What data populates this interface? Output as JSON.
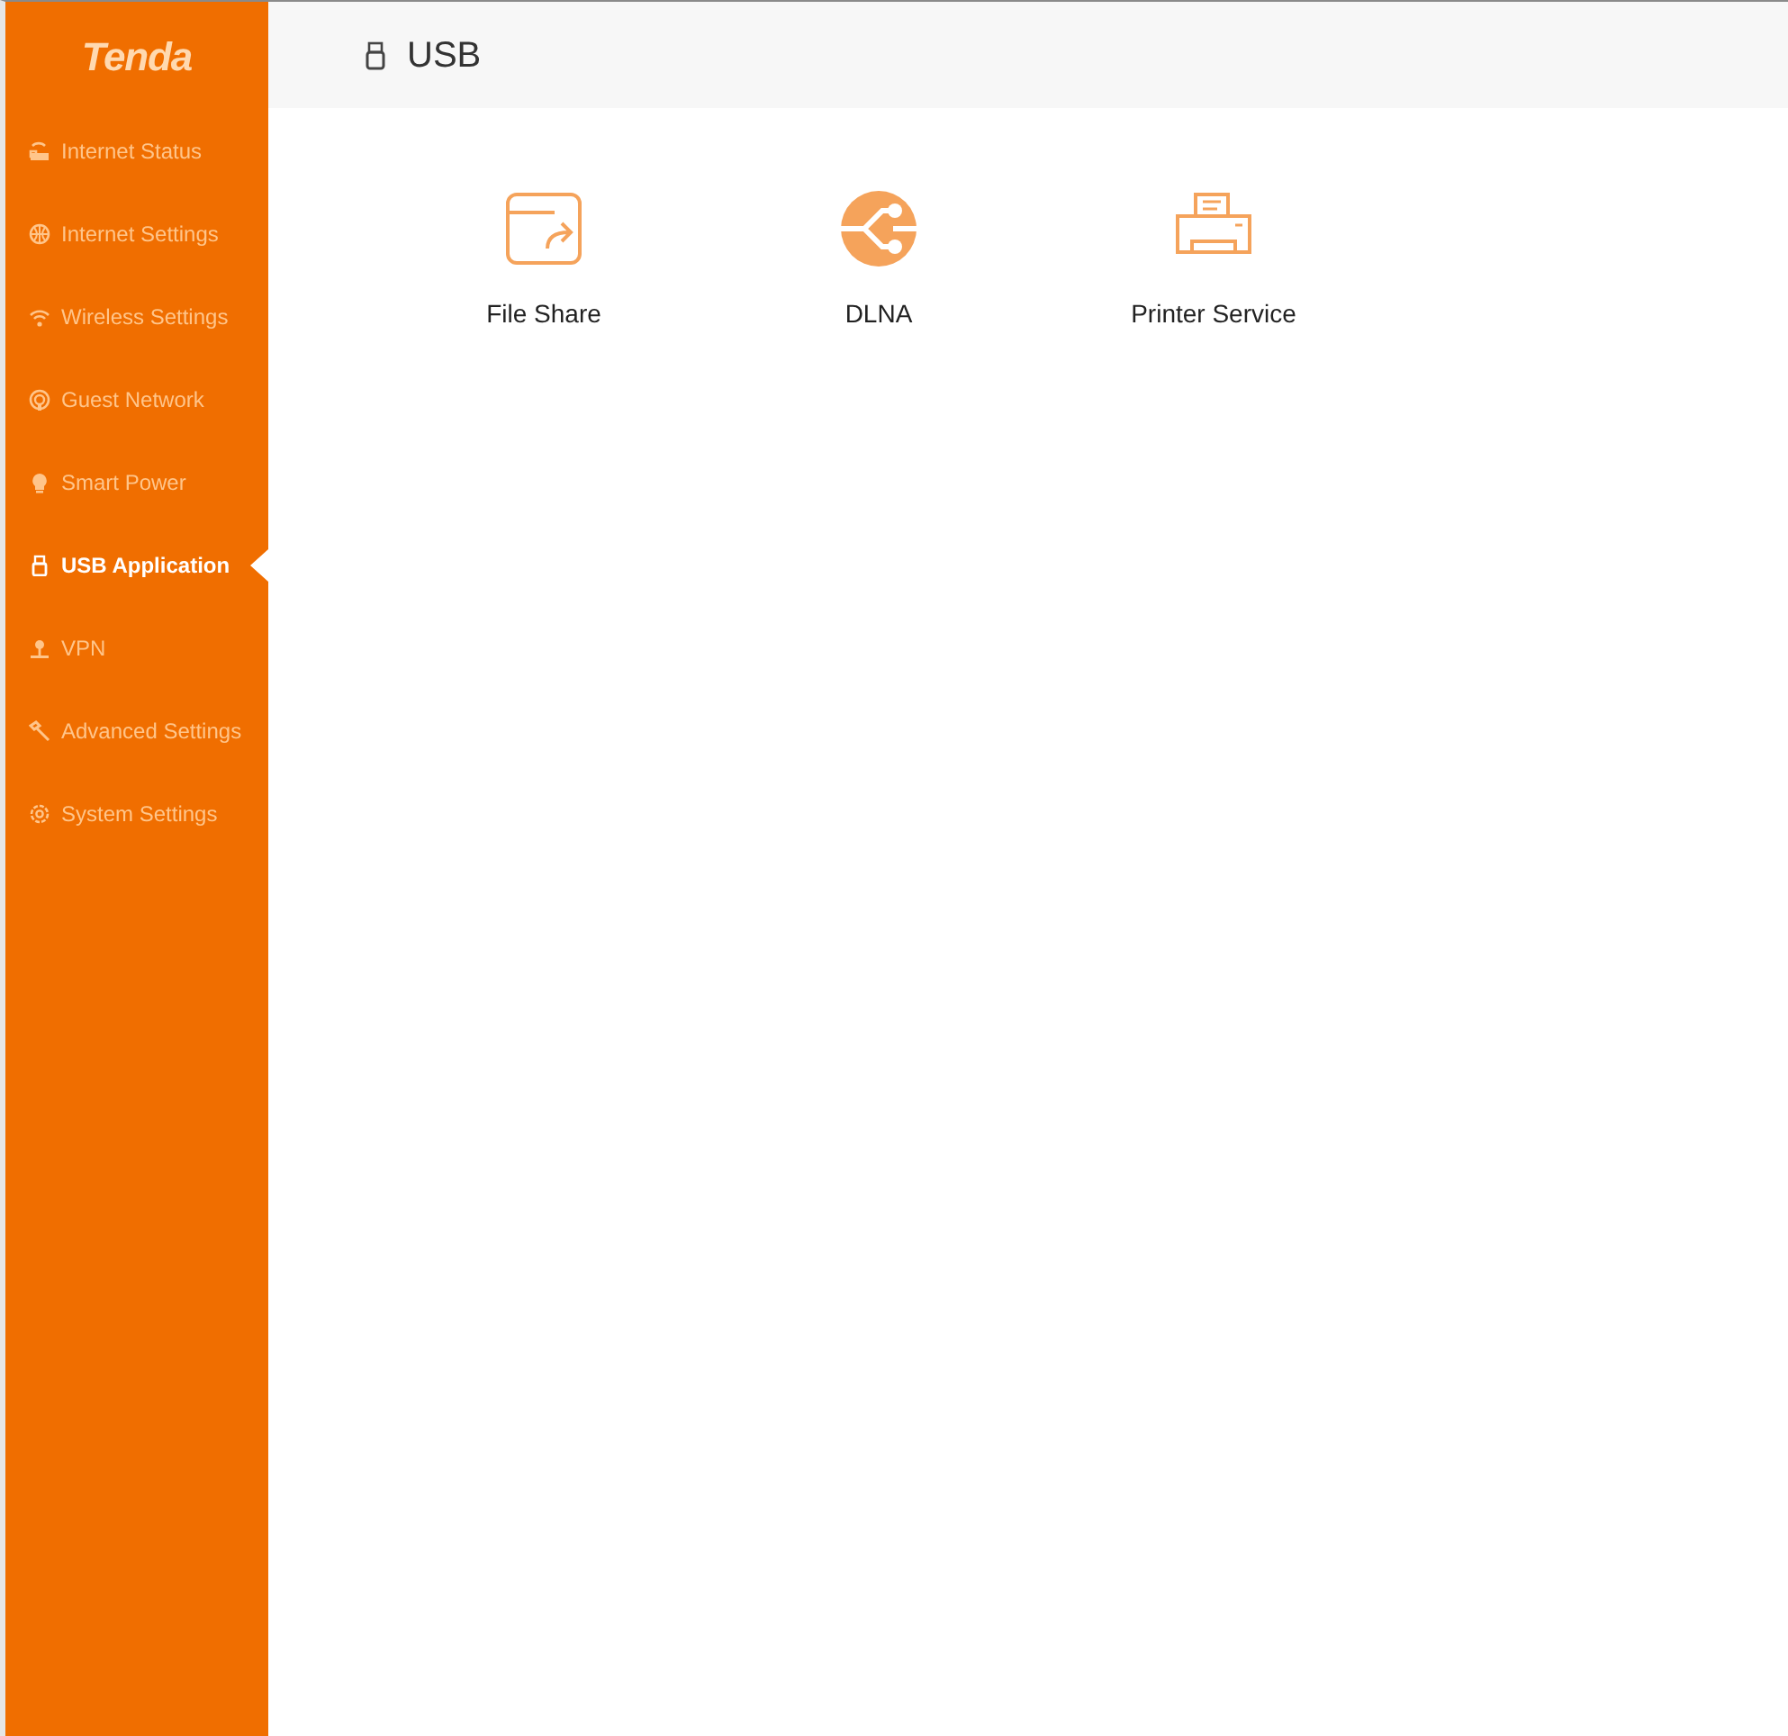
{
  "logo": "Tenda",
  "sidebar": {
    "items": [
      {
        "label": "Internet Status",
        "selected": false
      },
      {
        "label": "Internet Settings",
        "selected": false
      },
      {
        "label": "Wireless Settings",
        "selected": false
      },
      {
        "label": "Guest Network",
        "selected": false
      },
      {
        "label": "Smart Power",
        "selected": false
      },
      {
        "label": "USB Application",
        "selected": true
      },
      {
        "label": "VPN",
        "selected": false
      },
      {
        "label": "Advanced Settings",
        "selected": false
      },
      {
        "label": "System Settings",
        "selected": false
      }
    ]
  },
  "header": {
    "title": "USB"
  },
  "apps": [
    {
      "kind": "file-share",
      "label": "File Share"
    },
    {
      "kind": "dlna",
      "label": "DLNA"
    },
    {
      "kind": "printer",
      "label": "Printer Service"
    }
  ]
}
